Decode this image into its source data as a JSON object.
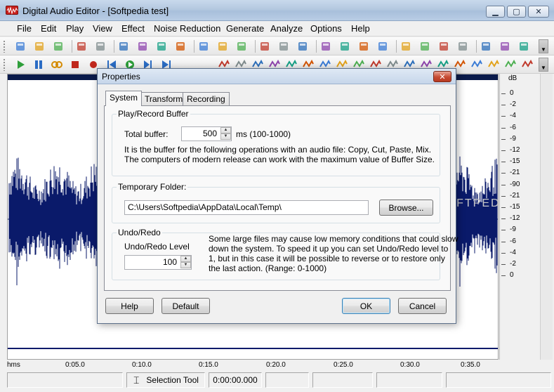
{
  "window": {
    "title": "Digital Audio Editor - [Softpedia test]",
    "controls": {
      "minimize": "▁",
      "maximize": "▢",
      "close": "✕"
    }
  },
  "menu": [
    "File",
    "Edit",
    "Play",
    "View",
    "Effect",
    "Noise Reduction",
    "Generate",
    "Analyze",
    "Options",
    "Help"
  ],
  "toolbar1_icons": [
    "new-file-icon",
    "open-folder-icon",
    "open-recent-icon",
    "save-icon",
    "save-as-icon",
    "copy-icon",
    "cut-icon",
    "paste-icon",
    "paste-mix-icon",
    "trim-icon",
    "undo-icon",
    "redo-icon",
    "select-all-icon",
    "insert-silence-icon",
    "filter-icon",
    "zoom-in-icon",
    "zoom-out-icon",
    "zoom-selection-icon",
    "zoom-all-icon",
    "zoom-in-vertical-icon",
    "zoom-out-vertical-icon",
    "zoom-full-icon",
    "zoom-fit-icon",
    "marker-add-icon",
    "marker-prev-icon",
    "marker-next-icon"
  ],
  "toolbar2_icons": [
    "play-icon",
    "pause-icon",
    "loop-icon",
    "stop-icon",
    "record-icon",
    "rewind-icon",
    "play-selection-icon",
    "play-to-end-icon",
    "skip-end-icon"
  ],
  "toolbar2_right_icons": [
    "fade-in-icon",
    "fade-out-icon",
    "normalize-icon",
    "amplify-icon",
    "echo-icon",
    "reverse-icon",
    "invert-icon",
    "silence-icon",
    "equalizer-icon",
    "compressor-icon",
    "delay-icon",
    "chorus-icon",
    "flanger-icon",
    "pitch-icon",
    "tempo-icon",
    "noise-gate-icon",
    "spectrum-icon",
    "channel-icon",
    "effects-chain-icon"
  ],
  "db_ruler": {
    "unit": "dB",
    "labels": [
      "0",
      "-2",
      "-4",
      "-6",
      "-9",
      "-12",
      "-15",
      "-21",
      "-90",
      "-21",
      "-15",
      "-12",
      "-9",
      "-6",
      "-4",
      "-2",
      "0"
    ]
  },
  "time_ruler": {
    "labels": [
      "hms",
      "0:05.0",
      "0:10.0",
      "0:15.0",
      "0:20.0",
      "0:25.0",
      "0:30.0",
      "0:35.0"
    ]
  },
  "status": {
    "tool": "Selection Tool",
    "time": "0:00:00.000"
  },
  "watermark": "SOFTPEDIA",
  "dialog": {
    "title": "Properties",
    "tabs": [
      "System",
      "Transform",
      "Recording"
    ],
    "active_tab": "System",
    "buffer": {
      "legend": "Play/Record Buffer",
      "total_label": "Total buffer:",
      "total_value": "500",
      "range": "ms (100-1000)",
      "desc1": "It is the buffer for the following operations with an audio file: Copy, Cut, Paste, Mix.",
      "desc2": "The computers of modern release can work with the maximum value of Buffer Size."
    },
    "temp": {
      "legend": "Temporary Folder:",
      "path": "C:\\Users\\Softpedia\\AppData\\Local\\Temp\\",
      "browse": "Browse..."
    },
    "undo": {
      "legend": "Undo/Redo",
      "level_label": "Undo/Redo Level",
      "level_value": "100",
      "desc1": "Some large files may cause low memory conditions that could slow",
      "desc2": "down the system. To speed it up you can set Undo/Redo level to",
      "desc3": "1, but in this case it will be possible to reverse or to restore only",
      "desc4": "the last action. (Range: 0-1000)"
    },
    "buttons": {
      "help": "Help",
      "default": "Default",
      "ok": "OK",
      "cancel": "Cancel"
    }
  },
  "colors": {
    "waveform": "#0a1a6a",
    "title_gradient_top": "#c9d9ec",
    "dialog_close": "#c64a32"
  }
}
